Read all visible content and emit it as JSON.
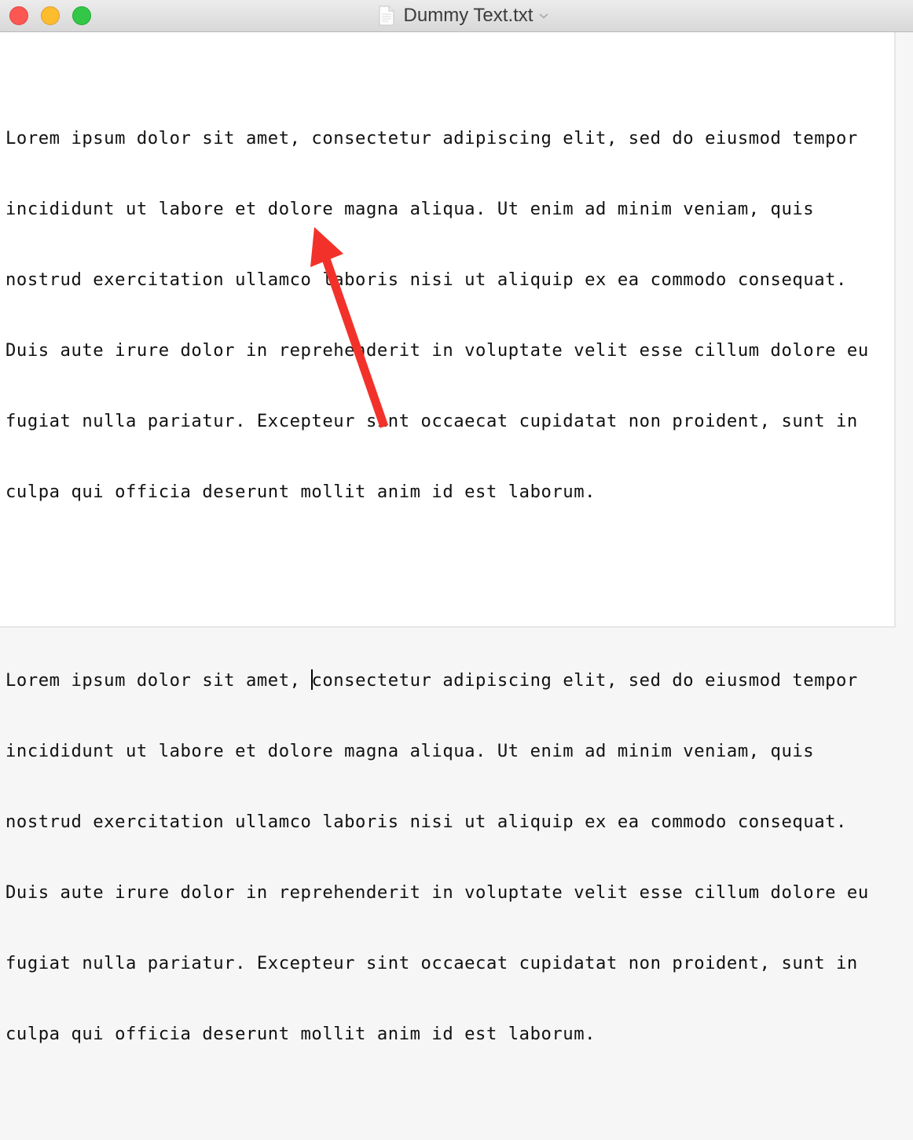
{
  "window": {
    "title": "Dummy Text.txt",
    "controls": [
      "close",
      "minimize",
      "zoom"
    ]
  },
  "document": {
    "paragraphs": [
      {
        "lines": [
          "Lorem ipsum dolor sit amet, consectetur adipiscing elit, sed do eiusmod tempor",
          "incididunt ut labore et dolore magna aliqua. Ut enim ad minim veniam, quis",
          "nostrud exercitation ullamco laboris nisi ut aliquip ex ea commodo consequat.",
          "Duis aute irure dolor in reprehenderit in voluptate velit esse cillum dolore eu",
          "fugiat nulla pariatur. Excepteur sint occaecat cupidatat non proident, sunt in",
          "culpa qui officia deserunt mollit anim id est laborum."
        ]
      },
      {
        "caret_line_before": "Lorem ipsum dolor sit amet, ",
        "caret_line_after": "consectetur adipiscing elit, sed do eiusmod tempor",
        "lines": [
          "incididunt ut labore et dolore magna aliqua. Ut enim ad minim veniam, quis",
          "nostrud exercitation ullamco laboris nisi ut aliquip ex ea commodo consequat.",
          "Duis aute irure dolor in reprehenderit in voluptate velit esse cillum dolore eu",
          "fugiat nulla pariatur. Excepteur sint occaecat cupidatat non proident, sunt in",
          "culpa qui officia deserunt mollit anim id est laborum."
        ]
      }
    ]
  },
  "annotation": {
    "type": "arrow",
    "color": "#f2322a",
    "points_to": "text-caret"
  }
}
